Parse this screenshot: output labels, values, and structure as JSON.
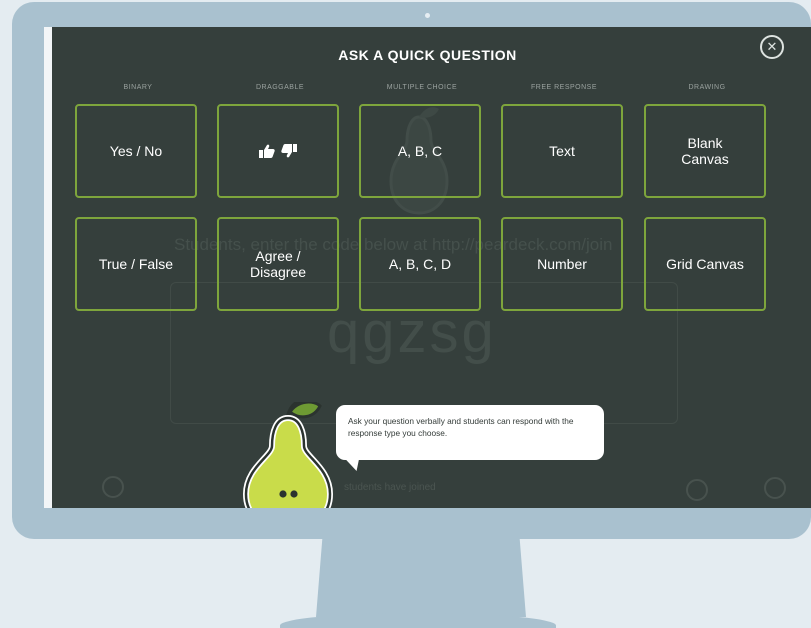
{
  "modal": {
    "title": "ASK A QUICK QUESTION",
    "close_icon": "close-icon",
    "columns": [
      {
        "label": "BINARY"
      },
      {
        "label": "DRAGGABLE"
      },
      {
        "label": "MULTIPLE CHOICE"
      },
      {
        "label": "FREE RESPONSE"
      },
      {
        "label": "DRAWING"
      }
    ],
    "buttons_row1": [
      {
        "label": "Yes / No"
      },
      {
        "label": "",
        "icons": [
          "thumbs-up-icon",
          "thumbs-down-icon"
        ]
      },
      {
        "label": "A, B, C"
      },
      {
        "label": "Text"
      },
      {
        "label": "Blank\nCanvas"
      }
    ],
    "buttons_row2": [
      {
        "label": "True / False"
      },
      {
        "label": "Agree /\nDisagree"
      },
      {
        "label": "A, B, C, D"
      },
      {
        "label": "Number"
      },
      {
        "label": "Grid Canvas"
      }
    ]
  },
  "tip": {
    "text": "Ask your question verbally and students can respond with the response type you choose."
  },
  "background": {
    "instruction": "Students, enter the code below at http://peardeck.com/join",
    "code": "qgzsg",
    "bottom_status": "students have joined"
  },
  "colors": {
    "screen_bg": "#353f3c",
    "button_border": "#7ea53c",
    "monitor": "#a9c1cf",
    "pear_green": "#c9dc4a"
  }
}
